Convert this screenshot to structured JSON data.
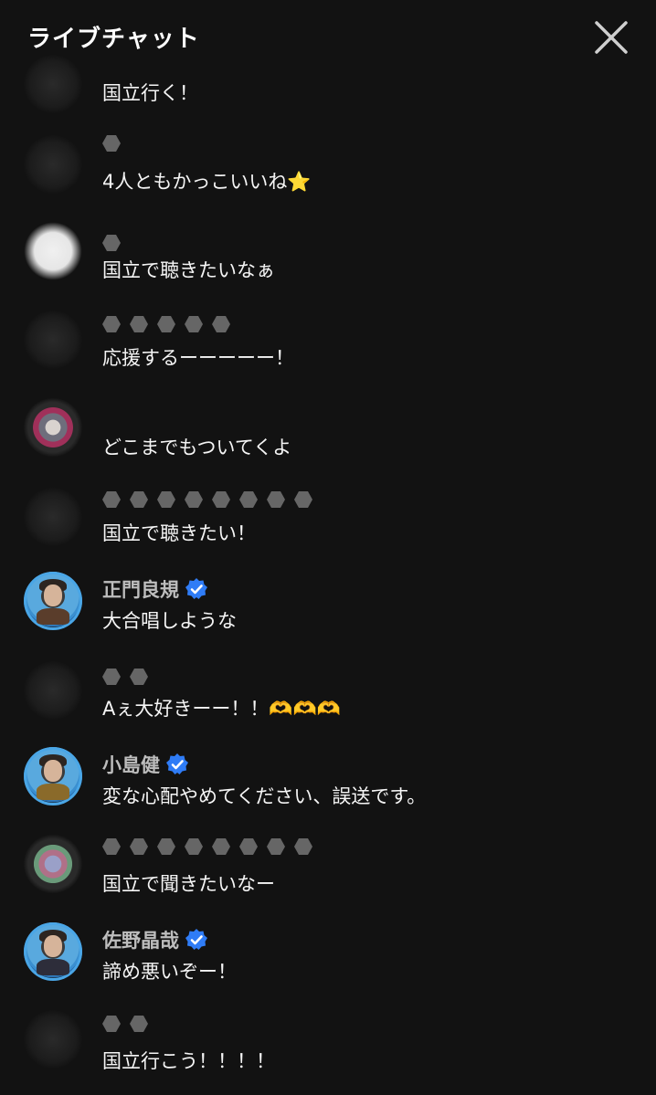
{
  "header": {
    "title": "ライブチャット",
    "close_icon": "close-icon"
  },
  "messages": [
    {
      "author": "",
      "official": false,
      "text": "国立行く！"
    },
    {
      "author": "",
      "official": false,
      "text": "4人ともかっこいいね⭐"
    },
    {
      "author": "",
      "official": false,
      "text": "国立で聴きたいなぁ"
    },
    {
      "author": "",
      "official": false,
      "text": "応援するーーーーー！"
    },
    {
      "author": "",
      "official": false,
      "text": "どこまでもついてくよ"
    },
    {
      "author": "",
      "official": false,
      "text": "国立で聴きたい！"
    },
    {
      "author": "正門良規",
      "official": true,
      "text": "大合唱しような"
    },
    {
      "author": "",
      "official": false,
      "text": "Aぇ大好きーー！！🫶🫶🫶"
    },
    {
      "author": "小島健",
      "official": true,
      "text": "変な心配やめてください、誤送です。"
    },
    {
      "author": "",
      "official": false,
      "text": "国立で聞きたいなー"
    },
    {
      "author": "佐野晶哉",
      "official": true,
      "text": "諦め悪いぞー！"
    },
    {
      "author": "",
      "official": false,
      "text": "国立行こう！！！！"
    }
  ],
  "colors": {
    "background": "#121212",
    "verified_badge": "#2f7cf6",
    "avatar_ring": "#4aa6e6"
  }
}
